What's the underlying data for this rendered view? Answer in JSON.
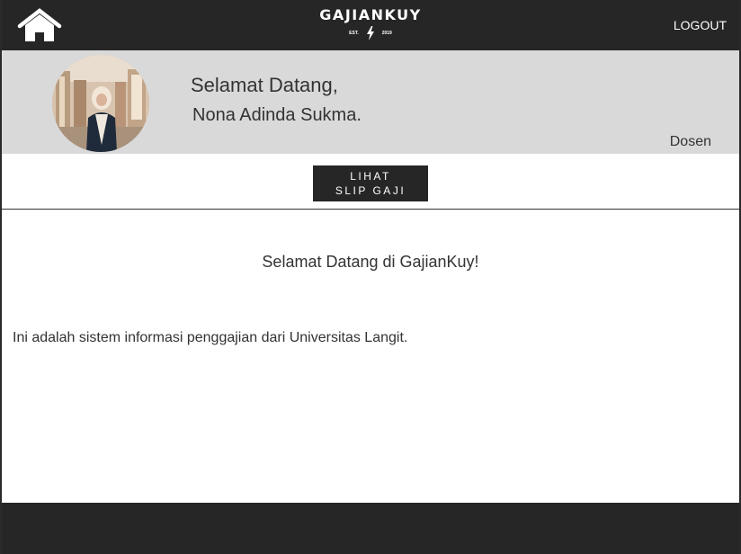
{
  "header": {
    "brand_name": "GAJIANKUY",
    "brand_est": "EST.",
    "brand_year": "2019",
    "logout_label": "LOGOUT",
    "home_icon": "home-icon",
    "bolt_icon": "lightning-bolt-icon"
  },
  "profile": {
    "greeting": "Selamat Datang,",
    "name": "Nona Adinda Sukma.",
    "role": "Dosen"
  },
  "actions": {
    "slip_line1": "LIHAT",
    "slip_line2": "SLIP GAJI"
  },
  "content": {
    "welcome": "Selamat Datang di GajianKuy!",
    "intro": "Ini adalah sistem informasi penggajian dari Universitas Langit."
  },
  "colors": {
    "bar": "#262626",
    "banner": "#d9d9d9",
    "text": "#333333"
  }
}
